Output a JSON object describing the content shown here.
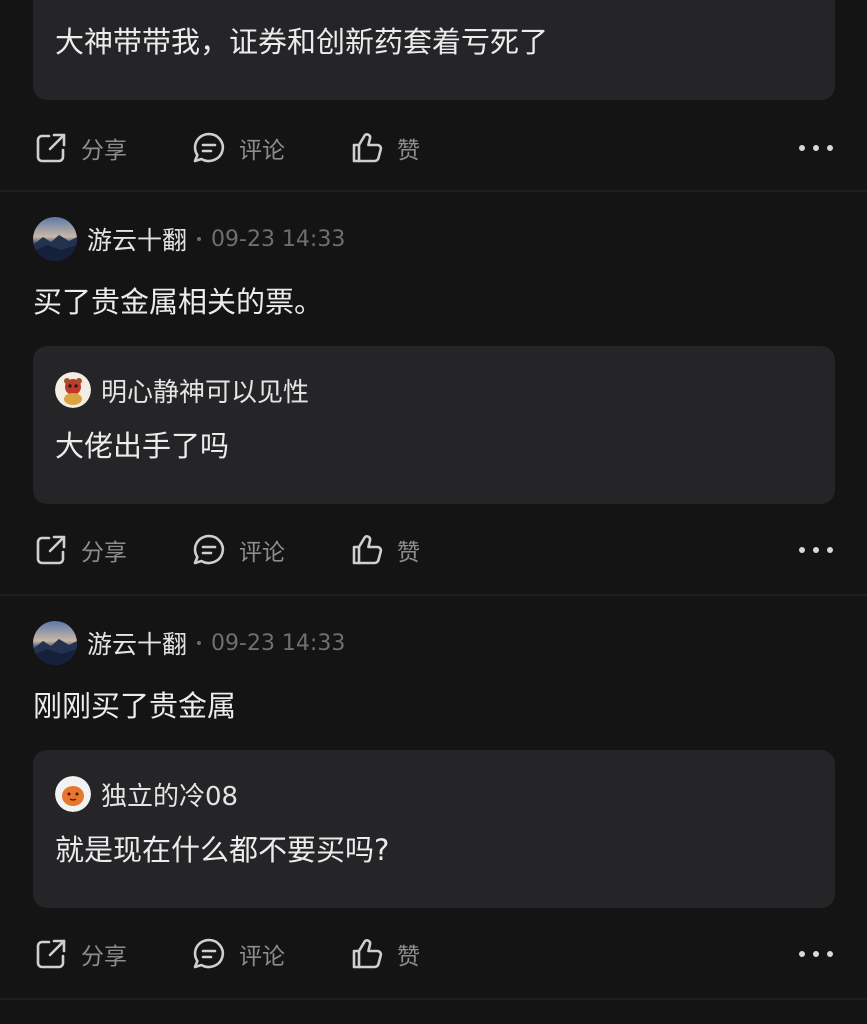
{
  "posts": [
    {
      "quote": {
        "text": "大神带带我，证券和创新药套着亏死了"
      },
      "actions": {
        "share": "分享",
        "comment": "评论",
        "like": "赞"
      }
    },
    {
      "author": "游云十翻",
      "time": "09-23 14:33",
      "body": "买了贵金属相关的票。",
      "quote": {
        "author": "明心静神可以见性",
        "text": "大佬出手了吗"
      },
      "actions": {
        "share": "分享",
        "comment": "评论",
        "like": "赞"
      }
    },
    {
      "author": "游云十翻",
      "time": "09-23 14:33",
      "body": "刚刚买了贵金属",
      "quote": {
        "author": "独立的冷08",
        "text": "就是现在什么都不要买吗?"
      },
      "actions": {
        "share": "分享",
        "comment": "评论",
        "like": "赞"
      }
    }
  ],
  "icons": {
    "share": "share-icon",
    "comment": "comment-icon",
    "like": "thumbs-up-icon",
    "more": "more-dots-icon"
  },
  "colors": {
    "background": "#141414",
    "card": "#252527",
    "muted_text": "#8d8d8d"
  }
}
